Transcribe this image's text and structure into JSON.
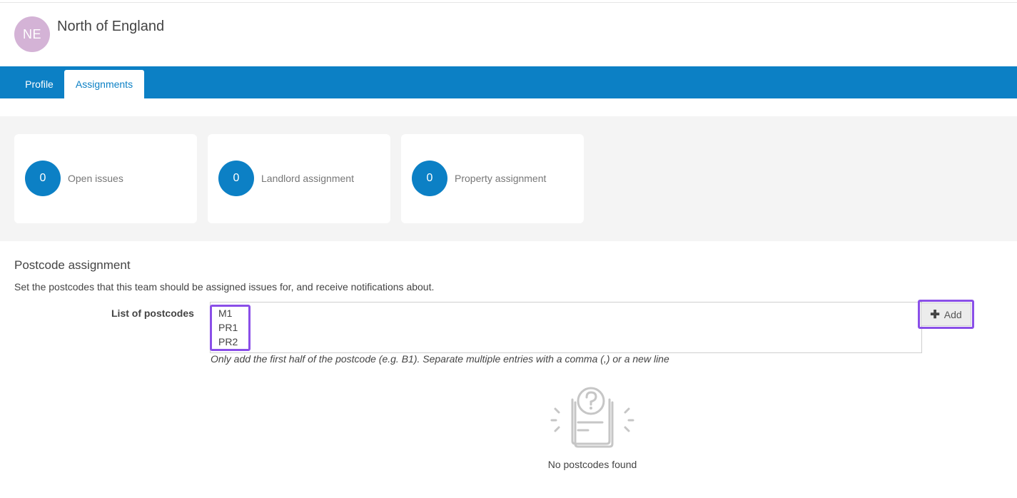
{
  "team": {
    "initials": "NE",
    "name": "North of England"
  },
  "tabs": [
    {
      "label": "Profile"
    },
    {
      "label": "Assignments"
    }
  ],
  "stats": [
    {
      "value": "0",
      "label": "Open issues"
    },
    {
      "value": "0",
      "label": "Landlord assignment"
    },
    {
      "value": "0",
      "label": "Property assignment"
    }
  ],
  "postcode_section": {
    "title": "Postcode assignment",
    "description": "Set the postcodes that this team should be assigned issues for, and receive notifications about.",
    "field_label": "List of postcodes",
    "postcodes": [
      "M1",
      "PR1",
      "PR2"
    ],
    "add_label": "Add",
    "hint": "Only add the first half of the postcode (e.g. B1). Separate multiple entries with a comma (,) or a new line",
    "empty_text": "No postcodes found"
  },
  "colors": {
    "brand": "#0c80c5",
    "avatar": "#d4b3d6",
    "highlight": "#8a4fe8"
  },
  "icons": {
    "add": "plus-icon",
    "empty": "question-document-icon"
  }
}
